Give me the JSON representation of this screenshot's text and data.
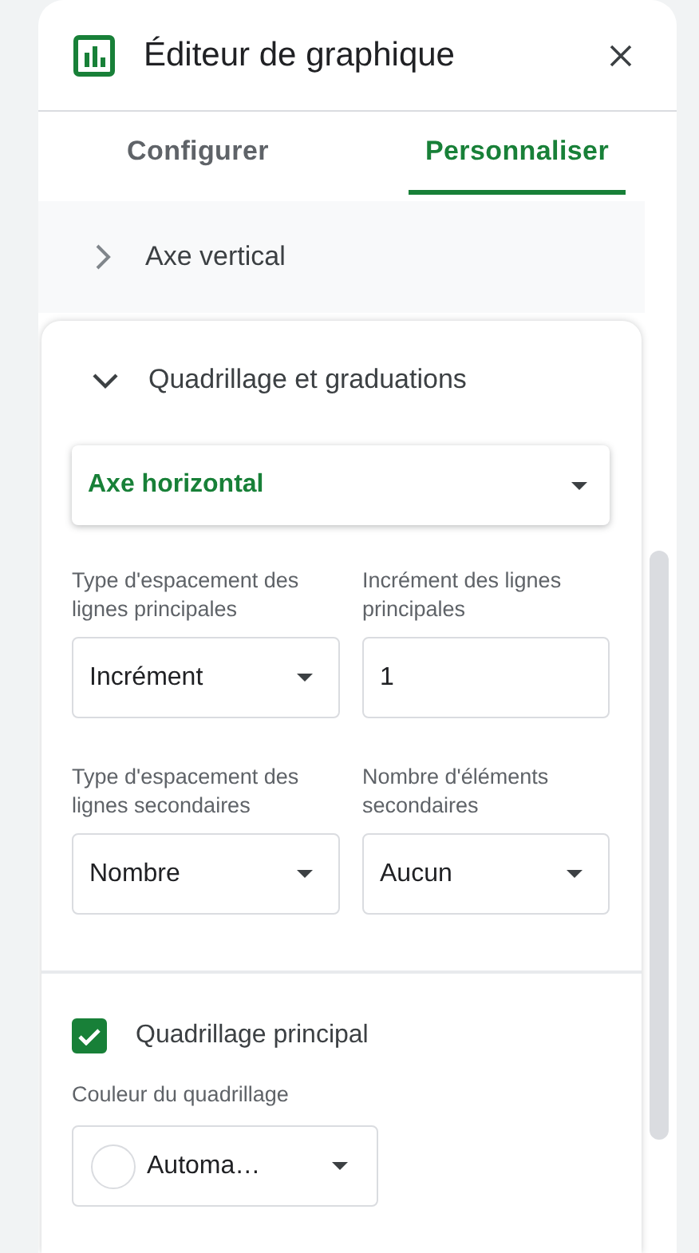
{
  "panel": {
    "title": "Éditeur de graphique"
  },
  "tabs": [
    {
      "label": "Configurer",
      "selected": false
    },
    {
      "label": "Personnaliser",
      "selected": true
    }
  ],
  "sections": [
    {
      "title": "Axe vertical",
      "expanded": false
    },
    {
      "title": "Quadrillage et graduations",
      "expanded": true,
      "axis_select": {
        "value": "Axe horizontal"
      },
      "fields": [
        {
          "label": "Type d'espacement des lignes principales",
          "kind": "select",
          "value": "Incrément"
        },
        {
          "label": "Incrément des lignes principales",
          "kind": "input",
          "value": "1"
        },
        {
          "label": "Type d'espacement des lignes secondaires",
          "kind": "select",
          "value": "Nombre"
        },
        {
          "label": "Nombre d'éléments secondaires",
          "kind": "select",
          "value": "Aucun"
        }
      ],
      "checkbox": {
        "label": "Quadrillage principal",
        "checked": true
      },
      "color_field": {
        "label": "Couleur du quadrillage",
        "value": "Automa…"
      }
    }
  ]
}
